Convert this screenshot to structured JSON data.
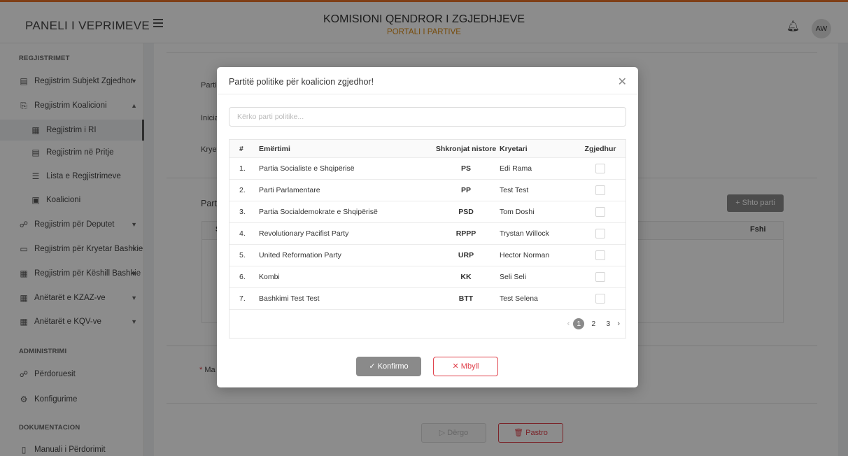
{
  "topbar": {
    "brand": "PANELI I VEPRIMEVE",
    "title": "KOMISIONI QENDROR I ZGJEDHJEVE",
    "subtitle": "PORTALI I PARTIVE",
    "avatar": "AW",
    "accent_color": "#e8742a"
  },
  "sidebar": {
    "sections": [
      {
        "title": "REGJISTRIMET"
      },
      {
        "title": "ADMINISTRIMI"
      },
      {
        "title": "DOKUMENTACION"
      }
    ],
    "items": [
      {
        "label": "Regjistrim Subjekt Zgjedhor",
        "icon": "register-icon"
      },
      {
        "label": "Regjistrim Koalicioni",
        "icon": "copy-icon"
      },
      {
        "label": "Regjistrim i RI",
        "icon": "grid-icon"
      },
      {
        "label": "Regjistrim në Pritje",
        "icon": "pending-icon"
      },
      {
        "label": "Lista e Regjistrimeve",
        "icon": "list-icon"
      },
      {
        "label": "Koalicioni",
        "icon": "document-icon"
      },
      {
        "label": "Regjistrim për Deputet",
        "icon": "users-icon"
      },
      {
        "label": "Regjistrim për Kryetar Bashkie",
        "icon": "id-card-icon"
      },
      {
        "label": "Regjistrim për Këshill Bashkie",
        "icon": "building-icon"
      },
      {
        "label": "Anëtarët e KZAZ-ve",
        "icon": "building-icon"
      },
      {
        "label": "Anëtarët e KQV-ve",
        "icon": "building-icon"
      },
      {
        "label": "Përdoruesit",
        "icon": "users-icon"
      },
      {
        "label": "Konfigurime",
        "icon": "gear-icon"
      },
      {
        "label": "Manuali i Përdorimit",
        "icon": "file-icon"
      }
    ]
  },
  "main": {
    "labels": {
      "partia": "Partia",
      "iniciativa": "Inicia",
      "kryetari": "Kryet",
      "partite": "Part",
      "mandatory": "Ma",
      "column_s": "S"
    },
    "shto_parti": "+ Shto parti",
    "fshi_header": "Fshi",
    "dergo": "Dërgo",
    "pastro": "Pastro"
  },
  "modal": {
    "title": "Partitë politike për koalicion zgjedhor!",
    "search_placeholder": "Kërko parti politike...",
    "columns": [
      "#",
      "Emërtimi",
      "Shkronjat nistore",
      "Kryetari",
      "Zgjedhur"
    ],
    "rows": [
      {
        "num": "1.",
        "name": "Partia Socialiste e Shqipërisë",
        "abbr": "PS",
        "leader": "Edi Rama"
      },
      {
        "num": "2.",
        "name": "Parti Parlamentare",
        "abbr": "PP",
        "leader": "Test Test"
      },
      {
        "num": "3.",
        "name": "Partia Socialdemokrate e Shqipërisë",
        "abbr": "PSD",
        "leader": "Tom Doshi"
      },
      {
        "num": "4.",
        "name": "Revolutionary Pacifist Party",
        "abbr": "RPPP",
        "leader": "Trystan Willock"
      },
      {
        "num": "5.",
        "name": "United Reformation Party",
        "abbr": "URP",
        "leader": "Hector Norman"
      },
      {
        "num": "6.",
        "name": "Kombi",
        "abbr": "KK",
        "leader": "Seli Seli"
      },
      {
        "num": "7.",
        "name": "Bashkimi Test Test",
        "abbr": "BTT",
        "leader": "Test Selena"
      }
    ],
    "pagination": {
      "pages": [
        "1",
        "2",
        "3"
      ],
      "current": "1"
    },
    "confirm": "Konfirmo",
    "close": "Mbyll"
  }
}
